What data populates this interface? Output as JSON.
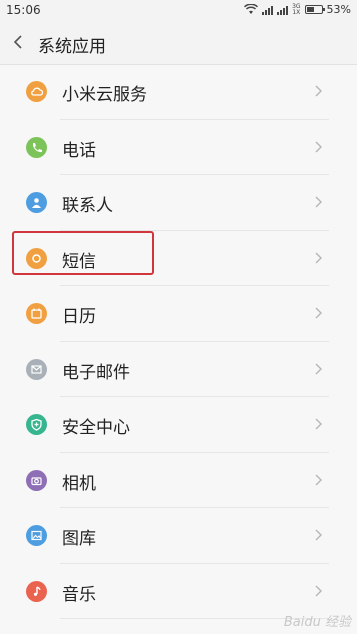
{
  "status_bar": {
    "time": "15:06",
    "network_top": "3G",
    "network_bottom": "1X",
    "battery_percent": "53%",
    "battery_level": 0.53
  },
  "header": {
    "title": "系统应用"
  },
  "items": [
    {
      "label": "小米云服务",
      "icon": "cloud-icon",
      "color": "#f0a040"
    },
    {
      "label": "电话",
      "icon": "phone-icon",
      "color": "#7cc35a"
    },
    {
      "label": "联系人",
      "icon": "person-icon",
      "color": "#4d9de0"
    },
    {
      "label": "短信",
      "icon": "message-icon",
      "color": "#f0a040"
    },
    {
      "label": "日历",
      "icon": "calendar-icon",
      "color": "#f0a040"
    },
    {
      "label": "电子邮件",
      "icon": "mail-icon",
      "color": "#a9b0b8"
    },
    {
      "label": "安全中心",
      "icon": "shield-icon",
      "color": "#37b58e"
    },
    {
      "label": "相机",
      "icon": "camera-icon",
      "color": "#8e6fb5"
    },
    {
      "label": "图库",
      "icon": "gallery-icon",
      "color": "#4d9de0"
    },
    {
      "label": "音乐",
      "icon": "music-icon",
      "color": "#e9634f"
    }
  ],
  "watermark": "Baidu 经验"
}
